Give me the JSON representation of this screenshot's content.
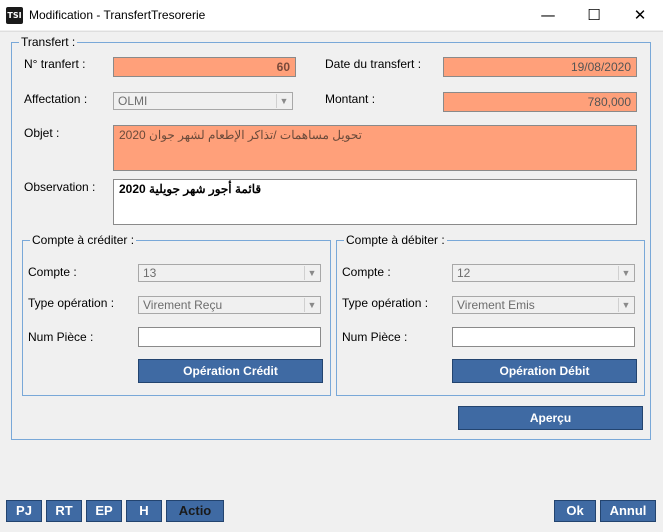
{
  "window": {
    "title": "Modification - TransfertTresorerie",
    "icon_text": "TSI",
    "minimize_glyph": "—",
    "maximize_glyph": "☐",
    "close_glyph": "✕"
  },
  "transfert": {
    "legend": "Transfert :",
    "no_label": "N° tranfert :",
    "no_value": "60",
    "date_label": "Date du transfert :",
    "date_value": "19/08/2020",
    "affectation_label": "Affectation :",
    "affectation_value": "OLMI",
    "montant_label": "Montant :",
    "montant_value": "780,000",
    "objet_label": "Objet :",
    "objet_value": "تحويل مساهمات /تذاكر الإطعام لشهر جوان 2020",
    "observation_label": "Observation :",
    "observation_value": "قائمة أجور شهر جويلية 2020"
  },
  "credit": {
    "legend": "Compte à créditer :",
    "compte_label": "Compte :",
    "compte_value": "13",
    "type_label": "Type opération :",
    "type_value": "Virement Reçu",
    "piece_label": "Num Pièce :",
    "piece_value": "",
    "button": "Opération Crédit"
  },
  "debit": {
    "legend": "Compte à débiter :",
    "compte_label": "Compte :",
    "compte_value": "12",
    "type_label": "Type opération :",
    "type_value": "Virement Emis",
    "piece_label": "Num Pièce :",
    "piece_value": "",
    "button": "Opération Débit"
  },
  "apercu_button": "Aperçu",
  "bottom": {
    "pj": "PJ",
    "rt": "RT",
    "ep": "EP",
    "h": "H",
    "action": "Actio",
    "ok": "Ok",
    "annul": "Annul"
  },
  "colors": {
    "required_field": "#ffa07a",
    "button": "#3f6aa3",
    "group_border": "#79a8d8"
  }
}
